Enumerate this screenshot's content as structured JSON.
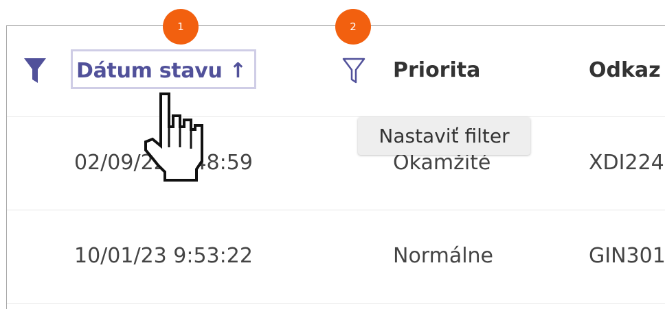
{
  "badges": {
    "one": "1",
    "two": "2"
  },
  "header": {
    "active_filter_icon": "filter-filled-icon",
    "sort_column_label": "Dátum stavu ↑",
    "filter_icon": "filter-outline-icon",
    "priority_label": "Priorita",
    "reference_label": "Odkaz"
  },
  "tooltip": {
    "text": "Nastaviť filter"
  },
  "rows": [
    {
      "date": "02/09/22 6:48:59",
      "priority": "Okamžité",
      "reference": "XDI224"
    },
    {
      "date": "10/01/23 9:53:22",
      "priority": "Normálne",
      "reference": "GIN301"
    }
  ],
  "cursor": "hand-pointer-icon",
  "colors": {
    "accent": "#51519a",
    "badge": "#f2600f",
    "header_border": "#cfcde6",
    "tooltip_bg": "#eeeeee"
  }
}
